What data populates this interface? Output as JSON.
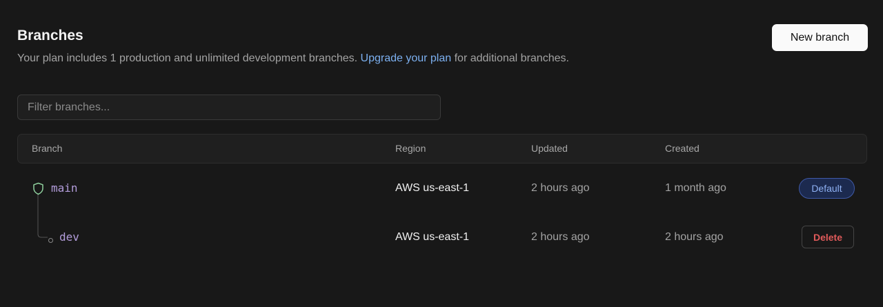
{
  "header": {
    "title": "Branches",
    "subtitle_prefix": "Your plan includes 1 production and unlimited development branches. ",
    "subtitle_link": "Upgrade your plan",
    "subtitle_suffix": " for additional branches."
  },
  "actions": {
    "new_branch_label": "New branch"
  },
  "filter": {
    "placeholder": "Filter branches...",
    "value": ""
  },
  "table": {
    "columns": [
      "Branch",
      "Region",
      "Updated",
      "Created"
    ],
    "rows": [
      {
        "branch": "main",
        "icon": "shield-icon",
        "region": "AWS us-east-1",
        "updated": "2 hours ago",
        "created": "1 month ago",
        "action_label": "Default"
      },
      {
        "branch": "dev",
        "icon": "branch-node-icon",
        "region": "AWS us-east-1",
        "updated": "2 hours ago",
        "created": "2 hours ago",
        "action_label": "Delete"
      }
    ]
  },
  "colors": {
    "background": "#181818",
    "link": "#7cb0f0",
    "branch_name": "#b39ddb",
    "shield": "#8fd19e",
    "default_badge": "#8fb1f3",
    "delete": "#e05a5a"
  }
}
